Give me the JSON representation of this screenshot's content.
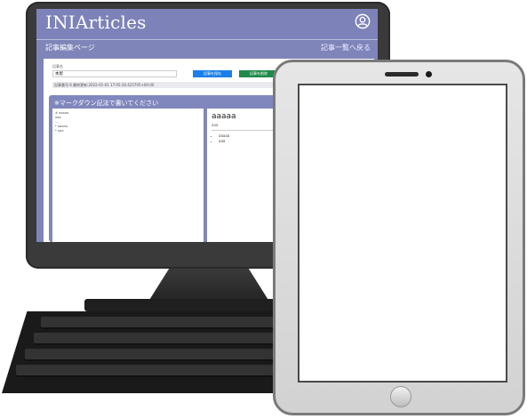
{
  "app": {
    "title": "INIArticles",
    "page_title": "記事編集ページ",
    "back_link": "記事一覧へ戻る"
  },
  "form": {
    "title_label": "記事名",
    "title_value": "本屋",
    "save_button": "記事を保存",
    "delete_button": "記事を削除",
    "meta_text": "記事番号:6 最終更新:2022-01-01 17:05:30.425705+00:00"
  },
  "editor": {
    "heading": "※マークダウン記法で書いてください",
    "markdown_lines": [
      "# aaaaa",
      "aaa",
      "---",
      "* aaaaa",
      "* aaa"
    ]
  },
  "preview": {
    "h1": "aaaaa",
    "paragraph": "aaa",
    "list": [
      "aaaaa",
      "aaa"
    ]
  },
  "colors": {
    "app_primary": "#7d83b8",
    "save_button": "#1a7fe8",
    "delete_button": "#1f8a4a",
    "third_button": "#d83b3b"
  },
  "icons": {
    "user": "user-circle-icon"
  }
}
